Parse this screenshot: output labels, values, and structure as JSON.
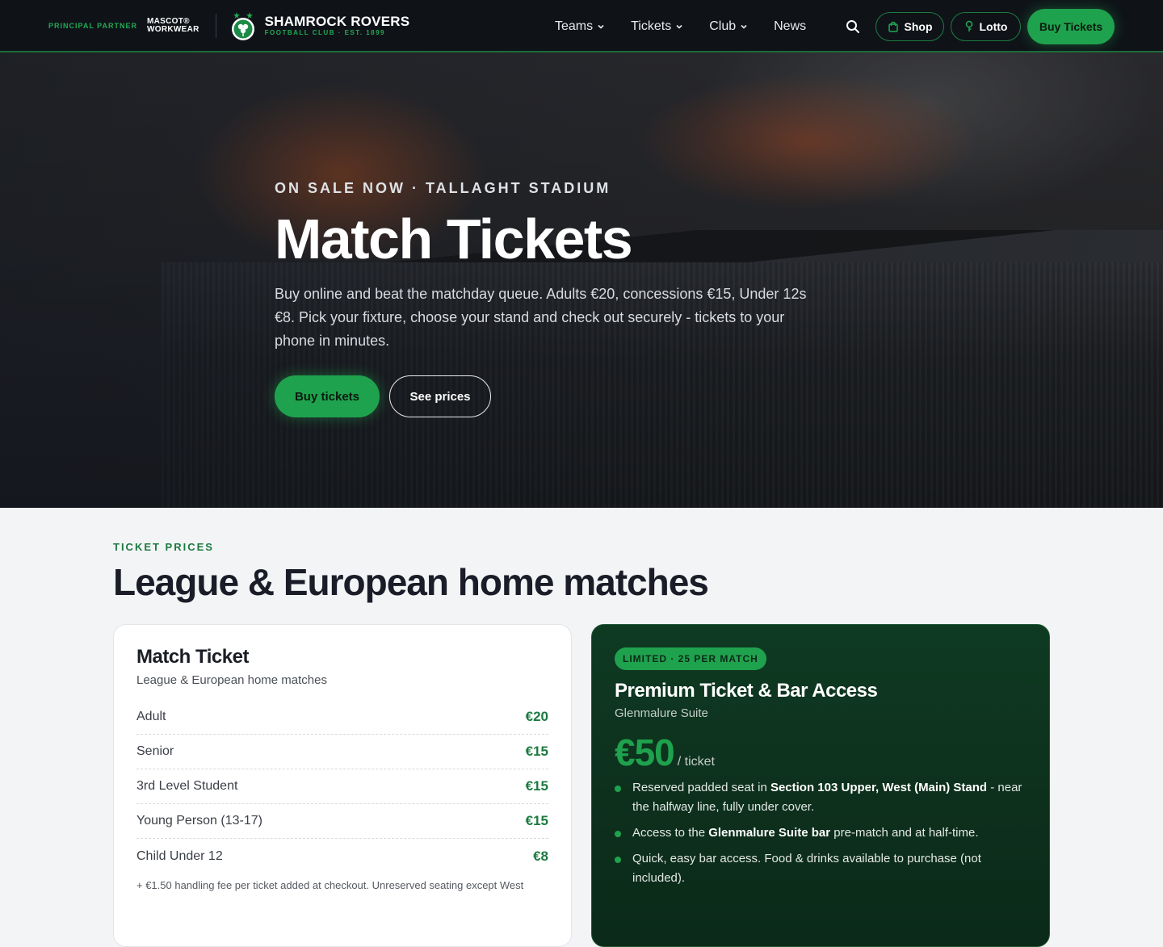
{
  "nav": {
    "partner_label": "PRINCIPAL PARTNER",
    "partner_name_line1": "MASCOT®",
    "partner_name_line2": "WORKWEAR",
    "club_title": "SHAMROCK ROVERS",
    "club_sub": "FOOTBALL CLUB · EST. 1899",
    "menu": [
      {
        "label": "Teams"
      },
      {
        "label": "Tickets"
      },
      {
        "label": "Club"
      },
      {
        "label": "News"
      }
    ],
    "shop_label": "Shop",
    "lotto_label": "Lotto",
    "buy_label": "Buy Tickets"
  },
  "hero": {
    "eyebrow": "ON SALE NOW · TALLAGHT STADIUM",
    "title": "Match Tickets",
    "description": "Buy online and beat the matchday queue. Adults €20, concessions €15, Under 12s €8. Pick your fixture, choose your stand and check out securely - tickets to your phone in minutes.",
    "buy_button": "Buy tickets",
    "prices_button": "See prices"
  },
  "prices": {
    "eyebrow": "TICKET PRICES",
    "title": "League & European home matches",
    "match_card": {
      "title": "Match Ticket",
      "subtitle": "League & European home matches",
      "rows": [
        {
          "label": "Adult",
          "price": "€20"
        },
        {
          "label": "Senior",
          "price": "€15"
        },
        {
          "label": "3rd Level Student",
          "price": "€15"
        },
        {
          "label": "Young Person (13-17)",
          "price": "€15"
        },
        {
          "label": "Child Under 12",
          "price": "€8"
        }
      ],
      "fine_print": "+ €1.50 handling fee per ticket added at checkout. Unreserved seating except West"
    },
    "premium_card": {
      "badge": "LIMITED · 25 PER MATCH",
      "title": "Premium Ticket & Bar Access",
      "subtitle": "Glenmalure Suite",
      "amount": "€50",
      "unit": "/ ticket",
      "features": [
        {
          "pre": "Reserved padded seat in ",
          "bold": "Section 103 Upper, West (Main) Stand",
          "post": " - near the halfway line, fully under cover."
        },
        {
          "pre": "Access to the ",
          "bold": "Glenmalure Suite bar",
          "post": " pre-match and at half-time."
        },
        {
          "pre": "Quick, easy bar access. Food & drinks available to purchase (not included).",
          "bold": "",
          "post": ""
        }
      ]
    }
  },
  "colors": {
    "brand_green": "#1fa24d",
    "nav_bg": "#0f1318",
    "premium_bg": "#0e3a22"
  }
}
